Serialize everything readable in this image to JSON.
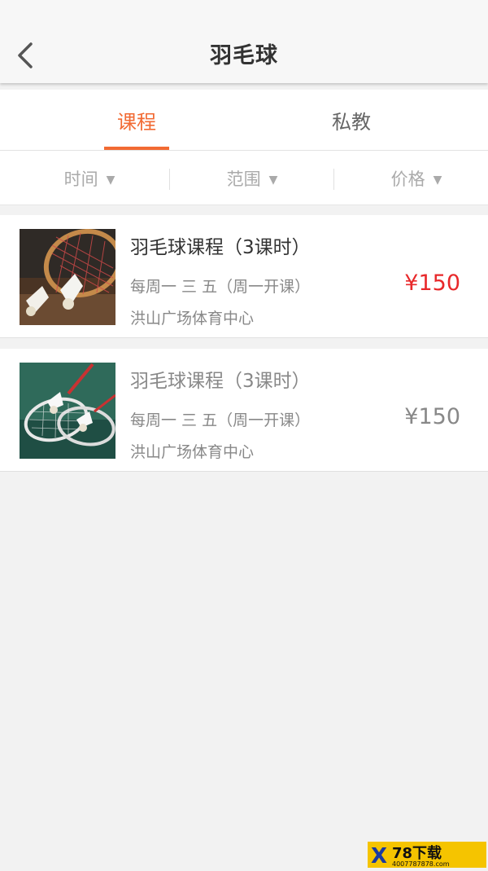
{
  "header": {
    "title": "羽毛球"
  },
  "tabs": [
    {
      "label": "课程",
      "active": true
    },
    {
      "label": "私教",
      "active": false
    }
  ],
  "filters": [
    {
      "label": "时间",
      "arrow": "▼"
    },
    {
      "label": "范围",
      "arrow": "▼"
    },
    {
      "label": "价格",
      "arrow": "▼"
    }
  ],
  "courses": [
    {
      "title": "羽毛球课程（3课时）",
      "schedule": "每周一 三 五（周一开课）",
      "venue": "洪山广场体育中心",
      "price": "¥150",
      "price_color": "#e8282a",
      "image": "badminton-racket-shuttlecock-photo"
    },
    {
      "title": "羽毛球课程（3课时）",
      "schedule": "每周一 三 五（周一开课）",
      "venue": "洪山广场体育中心",
      "price": "¥150",
      "price_color": "#888888",
      "image": "badminton-rackets-on-court-photo"
    }
  ],
  "watermark": {
    "brand": "78下载",
    "site": "4007787878.com"
  },
  "colors": {
    "accent": "#f26a33",
    "price_active": "#e8282a",
    "background": "#f2f2f2"
  }
}
